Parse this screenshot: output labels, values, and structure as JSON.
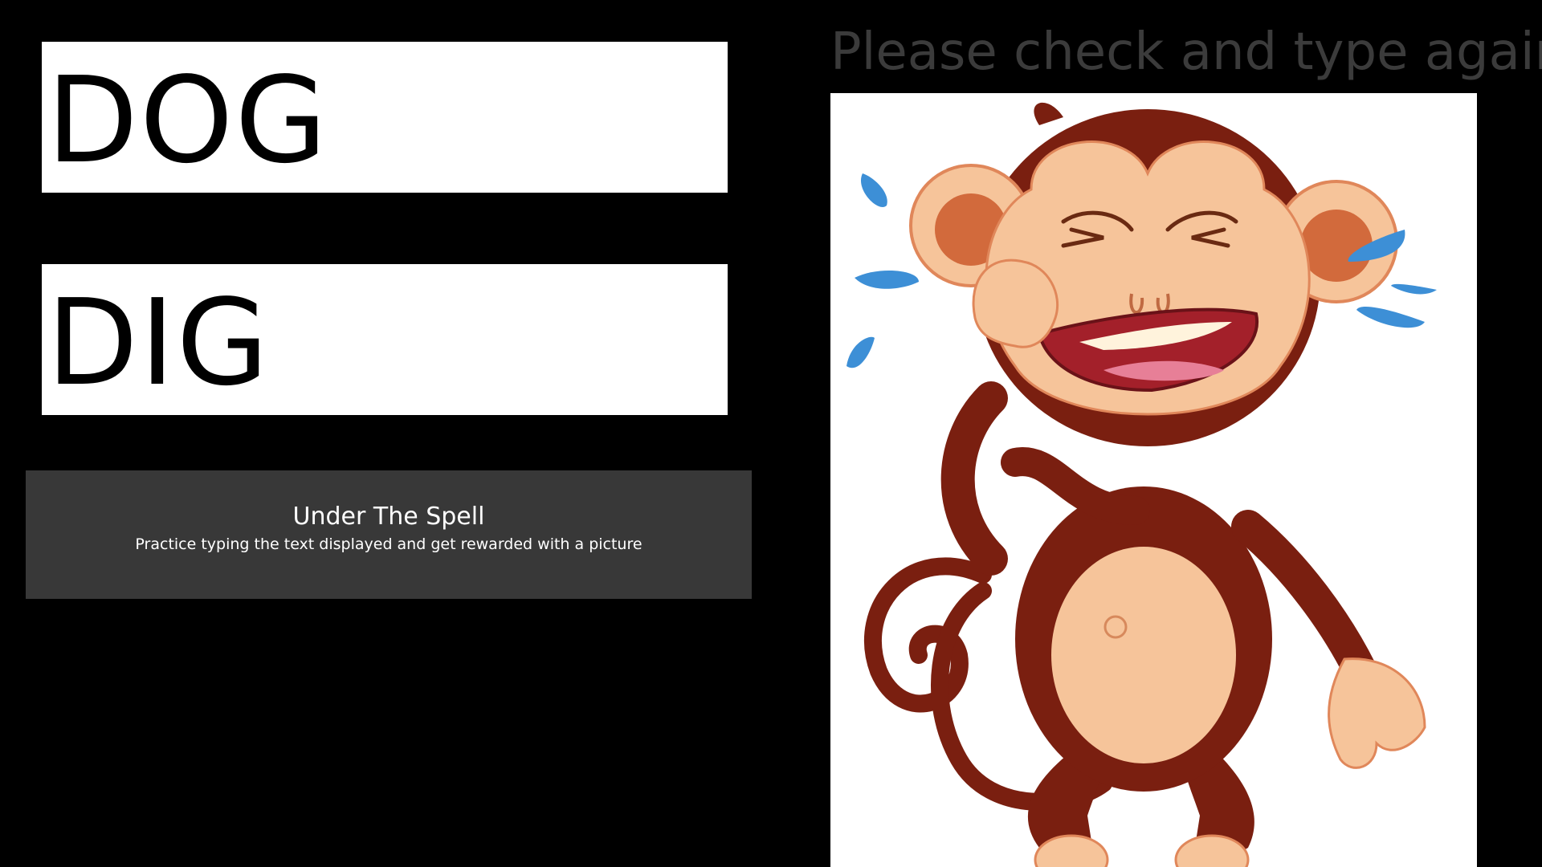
{
  "game": {
    "target_word": "DOG",
    "typed_word": "DIG",
    "feedback_message": "Please check and type again"
  },
  "info": {
    "title": "Under The Spell",
    "subtitle": "Practice typing the text displayed and get rewarded with a picture"
  },
  "reward_picture": {
    "subject": "crying-monkey",
    "colors": {
      "fur": "#7a1f10",
      "skin": "#f6c49a",
      "tears": "#3d8fd6",
      "mouth": "#a3202a"
    }
  },
  "colors": {
    "background": "#000000",
    "word_box": "#ffffff",
    "panel": "#383838",
    "feedback_text": "#3b3b3b"
  }
}
